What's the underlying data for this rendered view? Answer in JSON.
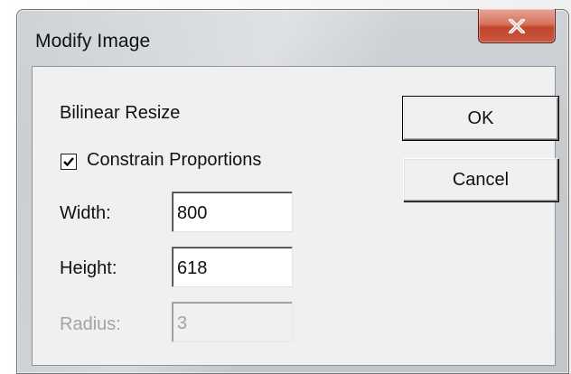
{
  "window": {
    "title": "Modify Image",
    "close_icon": "close-x-icon"
  },
  "dialog": {
    "method_label": "Bilinear Resize",
    "constrain": {
      "label": "Constrain Proportions",
      "checked": true
    },
    "width": {
      "label": "Width:",
      "value": "800"
    },
    "height": {
      "label": "Height:",
      "value": "618"
    },
    "radius": {
      "label": "Radius:",
      "value": "3",
      "enabled": false
    },
    "buttons": {
      "ok_label": "OK",
      "cancel_label": "Cancel"
    }
  }
}
